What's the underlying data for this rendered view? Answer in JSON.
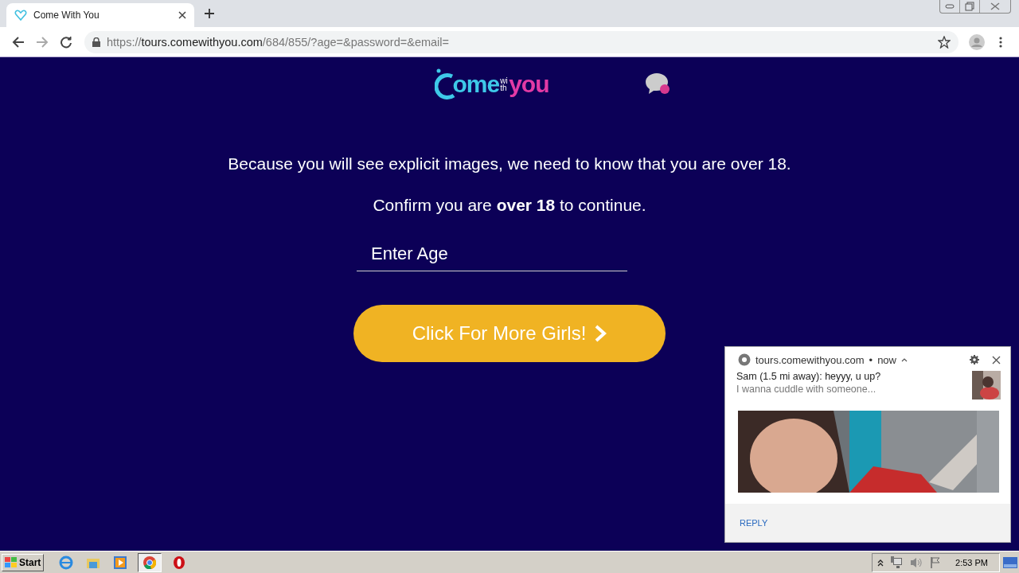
{
  "browser": {
    "tab": {
      "title": "Come With You",
      "selected": true
    },
    "url": {
      "scheme": "https://",
      "host": "tours.comewithyou.com",
      "path": "/684/855/?age=&password=&email="
    }
  },
  "page": {
    "logo": {
      "part_1": "ome",
      "part_2": "with",
      "part_3": "you"
    },
    "warning": "Because you will see explicit images, we need to know that you are over 18.",
    "confirm": "Confirm you are **over 18** to continue.",
    "age_field": {
      "placeholder": "Enter Age"
    },
    "button": "Click For More Girls!"
  },
  "notification": {
    "origin": "tours.comewithyou.com",
    "separator": "•",
    "time": "now",
    "title": "Sam (1.5 mi away): heyyy, u up?",
    "body": "I wanna cuddle with someone...",
    "action": "REPLY"
  },
  "taskbar": {
    "start": "Start",
    "clock": "2:53 PM"
  }
}
